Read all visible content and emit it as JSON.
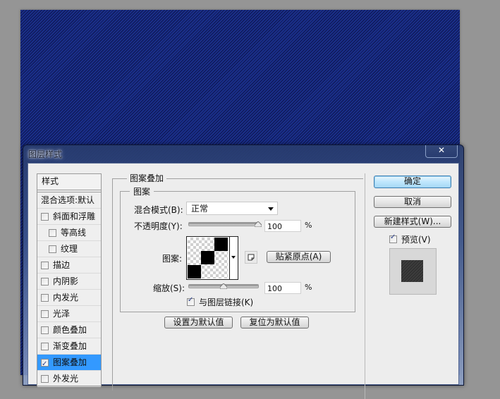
{
  "dialog": {
    "title": "图层样式",
    "close_label": "✕"
  },
  "styles_list": {
    "header": "样式",
    "blend_options": "混合选项:默认",
    "items": [
      {
        "label": "斜面和浮雕",
        "checked": false,
        "sub": false
      },
      {
        "label": "等高线",
        "checked": false,
        "sub": true
      },
      {
        "label": "纹理",
        "checked": false,
        "sub": true
      },
      {
        "label": "描边",
        "checked": false,
        "sub": false
      },
      {
        "label": "内阴影",
        "checked": false,
        "sub": false
      },
      {
        "label": "内发光",
        "checked": false,
        "sub": false
      },
      {
        "label": "光泽",
        "checked": false,
        "sub": false
      },
      {
        "label": "颜色叠加",
        "checked": false,
        "sub": false
      },
      {
        "label": "渐变叠加",
        "checked": false,
        "sub": false
      },
      {
        "label": "图案叠加",
        "checked": true,
        "sub": false,
        "selected": true
      },
      {
        "label": "外发光",
        "checked": false,
        "sub": false
      }
    ]
  },
  "pattern_overlay": {
    "group_title": "图案叠加",
    "subgroup_title": "图案",
    "blend_mode_label": "混合模式(B):",
    "blend_mode_value": "正常",
    "opacity_label": "不透明度(Y):",
    "opacity_value": "100",
    "opacity_percent": 100,
    "pattern_label": "图案:",
    "snap_to_origin_label": "贴紧原点(A)",
    "scale_label": "缩放(S):",
    "scale_value": "100",
    "scale_percent": 100,
    "link_with_layer_label": "与图层链接(K)",
    "link_with_layer_checked": true,
    "percent_sign": "%",
    "make_default_label": "设置为默认值",
    "reset_default_label": "复位为默认值"
  },
  "actions": {
    "ok_label": "确定",
    "cancel_label": "取消",
    "new_style_label": "新建样式(W)...",
    "preview_label": "预览(V)",
    "preview_checked": true
  },
  "colors": {
    "canvas_blue": "#101e66",
    "selection_blue": "#3399ff",
    "workspace_gray": "#959595"
  }
}
